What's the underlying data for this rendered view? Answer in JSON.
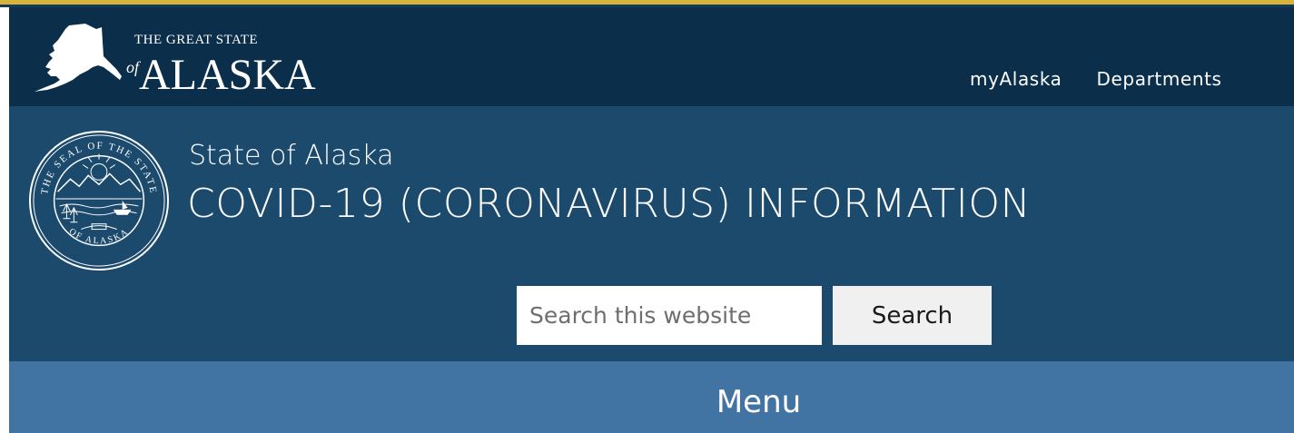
{
  "header": {
    "logo_line1": "THE GREAT STATE",
    "logo_line2": "ALASKA",
    "logo_of": "of",
    "nav": [
      {
        "label": "myAlaska"
      },
      {
        "label": "Departments"
      }
    ]
  },
  "site": {
    "subtitle": "State of Alaska",
    "title": "COVID-19 (CORONAVIRUS) INFORMATION",
    "seal_text_top": "THE SEAL OF THE STATE",
    "seal_text_bottom": "OF ALASKA"
  },
  "search": {
    "placeholder": "Search this website",
    "value": "",
    "button_label": "Search"
  },
  "menu": {
    "label": "Menu"
  },
  "colors": {
    "top_bar": "#0b2e4b",
    "title_section": "#1b4a6d",
    "menu_bar": "#4274a3",
    "accent_gold": "#d9b23a"
  }
}
